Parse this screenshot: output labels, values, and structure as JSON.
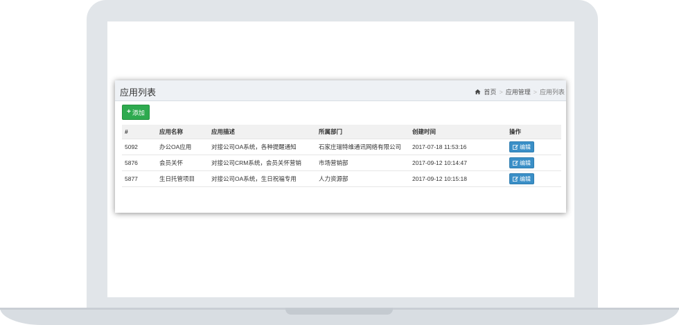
{
  "page_title": "应用列表",
  "breadcrumb": {
    "home": "首页",
    "middle": "应用管理",
    "current": "应用列表"
  },
  "add_label": "添加",
  "table": {
    "headers": [
      "#",
      "应用名称",
      "应用描述",
      "所属部门",
      "创建时间",
      "操作"
    ],
    "rows": [
      [
        "5092",
        "办公OA应用",
        "对接公司OA系统，各种提醒通知",
        "石家庄瑞特维通讯网络有限公司",
        "2017-07-18 11:53:16",
        "编辑"
      ],
      [
        "5876",
        "会员关怀",
        "对接公司CRM系统，会员关怀营销",
        "市场营销部",
        "2017-09-12 10:14:47",
        "编辑"
      ],
      [
        "5877",
        "生日托管项目",
        "对接公司OA系统，生日祝福专用",
        "人力资源部",
        "2017-09-12 10:15:18",
        "编辑"
      ]
    ]
  },
  "icons": {
    "home": "home-icon",
    "add": "plus-icon",
    "edit": "edit-icon"
  },
  "colors": {
    "add_button": "#2eaa4f",
    "edit_button": "#3a8fc7",
    "header_bg": "#eef1f5"
  }
}
